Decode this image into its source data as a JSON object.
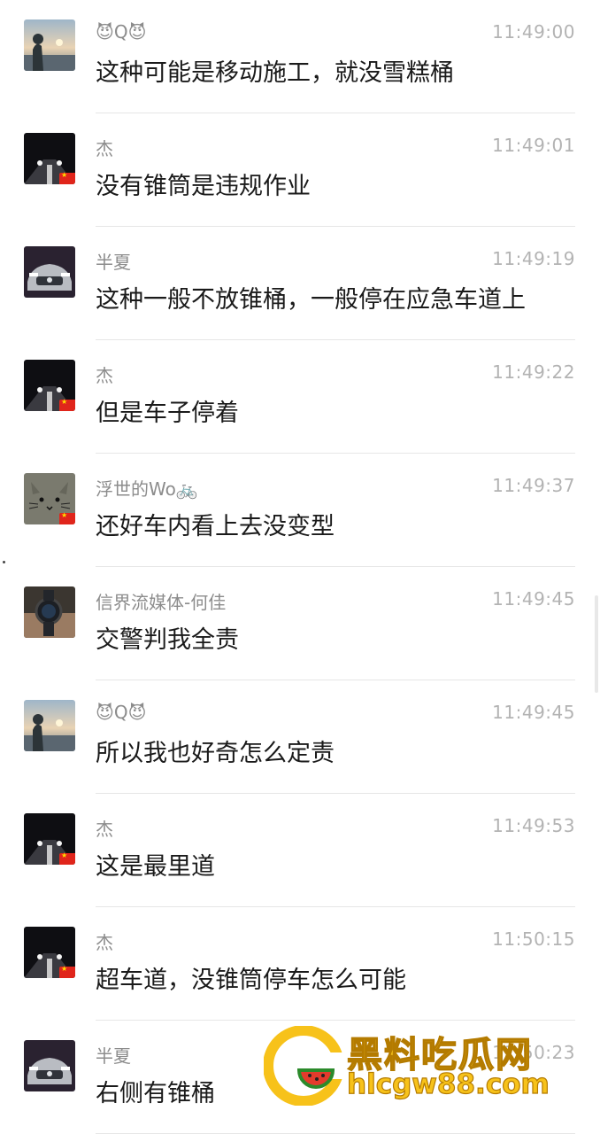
{
  "messages": [
    {
      "avatar": "sunset-man",
      "name": "😈Q😈",
      "time": "11:49:00",
      "text": "这种可能是移动施工，就没雪糕桶",
      "flag": false
    },
    {
      "avatar": "night-road",
      "name": "杰",
      "time": "11:49:01",
      "text": "没有锥筒是违规作业",
      "flag": true
    },
    {
      "avatar": "mercedes-car",
      "name": "半夏",
      "time": "11:49:19",
      "text": "这种一般不放锥桶，一般停在应急车道上",
      "flag": false
    },
    {
      "avatar": "night-road",
      "name": "杰",
      "time": "11:49:22",
      "text": "但是车子停着",
      "flag": true
    },
    {
      "avatar": "gray-cat",
      "name": "浮世的Wo🚲",
      "time": "11:49:37",
      "text": "还好车内看上去没变型",
      "flag": true
    },
    {
      "avatar": "wristwatch",
      "name": "信界流媒体-何佳",
      "time": "11:49:45",
      "text": "交警判我全责",
      "flag": false
    },
    {
      "avatar": "sunset-man",
      "name": "😈Q😈",
      "time": "11:49:45",
      "text": "所以我也好奇怎么定责",
      "flag": false
    },
    {
      "avatar": "night-road",
      "name": "杰",
      "time": "11:49:53",
      "text": "这是最里道",
      "flag": true
    },
    {
      "avatar": "night-road",
      "name": "杰",
      "time": "11:50:15",
      "text": "超车道，没锥筒停车怎么可能",
      "flag": true
    },
    {
      "avatar": "mercedes-car",
      "name": "半夏",
      "time": "11:50:23",
      "text": "右侧有锥桶",
      "flag": false
    }
  ],
  "watermark": {
    "title": "黑料吃瓜网",
    "url": "hlcgw88.com"
  },
  "colors": {
    "name": "#8c8c8c",
    "time": "#b3b3b3",
    "message": "#1a1a1a",
    "separator": "#e6e6e6",
    "watermark": "#f7c21a"
  }
}
